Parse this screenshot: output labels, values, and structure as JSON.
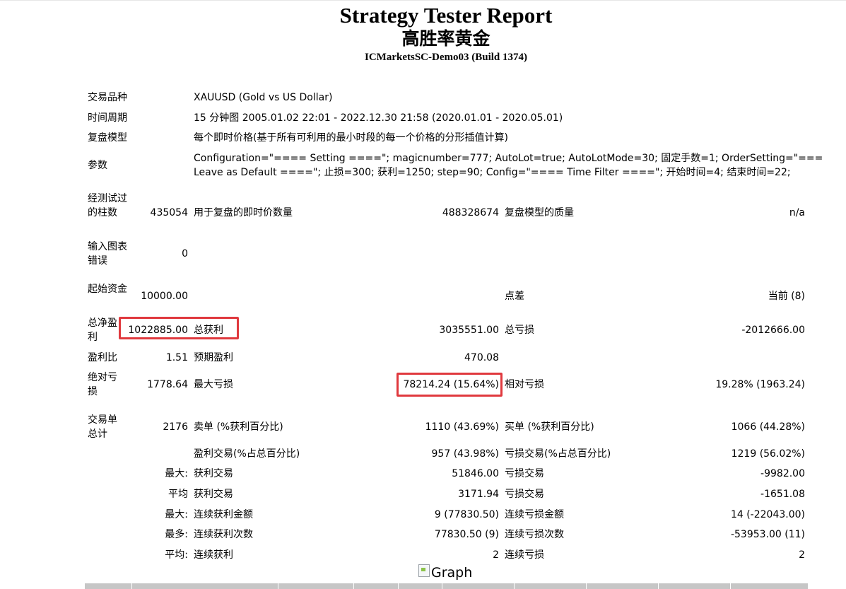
{
  "header": {
    "title": "Strategy Tester Report",
    "subtitle": "高胜率黄金",
    "server": "ICMarketsSC-Demo03 (Build 1374)"
  },
  "info": {
    "symbol_label": "交易品种",
    "symbol_value": "XAUUSD (Gold vs US Dollar)",
    "period_label": "时间周期",
    "period_value": "15 分钟图 2005.01.02 22:01 - 2022.12.30 21:58 (2020.01.01 - 2020.05.01)",
    "model_label": "复盘模型",
    "model_value": "每个即时价格(基于所有可利用的最小时段的每一个价格的分形插值计算)",
    "params_label": "参数",
    "params_line1": "Configuration=\"==== Setting ====\"; magicnumber=777; AutoLot=true; AutoLotMode=30; 固定手数=1; OrderSetting=\"===",
    "params_line2": "Leave as Default ====\"; 止损=300; 获利=1250; step=90; Config=\"==== Time Filter ====\"; 开始时间=4; 结束时间=22;"
  },
  "stats": {
    "bars_label": "经测试过的柱数",
    "bars_value": "435054",
    "ticks_label": "用于复盘的即时价数量",
    "ticks_value": "488328674",
    "quality_label": "复盘模型的质量",
    "quality_value": "n/a",
    "errors_label": "输入图表错误",
    "errors_value": "0",
    "deposit_label": "起始资金",
    "deposit_value": "10000.00",
    "spread_label": "点差",
    "spread_value": "当前 (8)",
    "net_profit_label": "总净盈利",
    "net_profit_value": "1022885.00",
    "gross_profit_label": "总获利",
    "gross_profit_value": "3035551.00",
    "gross_loss_label": "总亏损",
    "gross_loss_value": "-2012666.00",
    "profit_factor_label": "盈利比",
    "profit_factor_value": "1.51",
    "expected_payoff_label": "预期盈利",
    "expected_payoff_value": "470.08",
    "abs_dd_label": "绝对亏损",
    "abs_dd_value": "1778.64",
    "max_dd_label": "最大亏损",
    "max_dd_value": "78214.24 (15.64%)",
    "rel_dd_label": "相对亏损",
    "rel_dd_value": "19.28% (1963.24)",
    "total_trades_label": "交易单总计",
    "total_trades_value": "2176",
    "short_label": "卖单 (%获利百分比)",
    "short_value": "1110 (43.69%)",
    "long_label": "买单 (%获利百分比)",
    "long_value": "1066 (44.28%)",
    "win_trades_label": "盈利交易(%占总百分比)",
    "win_trades_value": "957 (43.98%)",
    "loss_trades_label": "亏损交易(%占总百分比)",
    "loss_trades_value": "1219 (56.02%)",
    "largest_prefix": "最大:",
    "largest_win_label": "获利交易",
    "largest_win_value": "51846.00",
    "largest_loss_label": "亏损交易",
    "largest_loss_value": "-9982.00",
    "average_prefix": "平均",
    "average_win_label": "获利交易",
    "average_win_value": "3171.94",
    "average_loss_label": "亏损交易",
    "average_loss_value": "-1651.08",
    "max_cons_prefix": "最大:",
    "max_cons_win_label": "连续获利金额",
    "max_cons_win_value": "9 (77830.50)",
    "max_cons_loss_label": "连续亏损金额",
    "max_cons_loss_value": "14 (-22043.00)",
    "most_cons_prefix": "最多:",
    "most_cons_win_label": "连续获利次数",
    "most_cons_win_value": "77830.50 (9)",
    "most_cons_loss_label": "连续亏损次数",
    "most_cons_loss_value": "-53953.00 (11)",
    "avg_cons_prefix": "平均:",
    "avg_cons_win_label": "连续获利",
    "avg_cons_win_value": "2",
    "avg_cons_loss_label": "连续亏损",
    "avg_cons_loss_value": "2"
  },
  "graph": {
    "alt_text": "Graph"
  },
  "colors": {
    "highlight": "#e0393e",
    "bar": "#c6c6c6"
  }
}
